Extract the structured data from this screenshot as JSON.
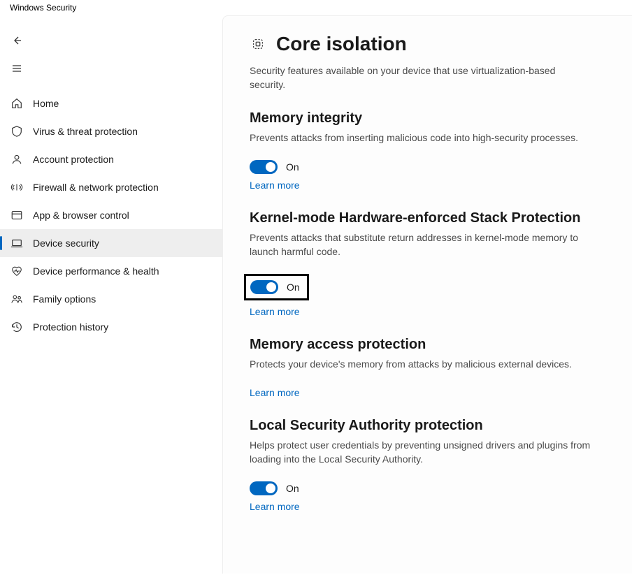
{
  "window_title": "Windows Security",
  "sidebar": {
    "items": [
      {
        "id": "home",
        "label": "Home"
      },
      {
        "id": "virus-threat",
        "label": "Virus & threat protection"
      },
      {
        "id": "account-protection",
        "label": "Account protection"
      },
      {
        "id": "firewall",
        "label": "Firewall & network protection"
      },
      {
        "id": "app-browser",
        "label": "App & browser control"
      },
      {
        "id": "device-security",
        "label": "Device security",
        "selected": true
      },
      {
        "id": "performance-health",
        "label": "Device performance & health"
      },
      {
        "id": "family-options",
        "label": "Family options"
      },
      {
        "id": "protection-history",
        "label": "Protection history"
      }
    ]
  },
  "page": {
    "title": "Core isolation",
    "subtitle": "Security features available on your device that use virtualization-based security."
  },
  "sections": {
    "memory_integrity": {
      "title": "Memory integrity",
      "desc": "Prevents attacks from inserting malicious code into high-security processes.",
      "toggle_state": "On",
      "learn_more": "Learn more"
    },
    "kmhsp": {
      "title": "Kernel-mode Hardware-enforced Stack Protection",
      "desc": "Prevents attacks that substitute return addresses in kernel-mode memory to launch harmful code.",
      "toggle_state": "On",
      "learn_more": "Learn more"
    },
    "memory_access": {
      "title": "Memory access protection",
      "desc": "Protects your device's memory from attacks by malicious external devices.",
      "learn_more": "Learn more"
    },
    "lsa": {
      "title": "Local Security Authority protection",
      "desc": "Helps protect user credentials by preventing unsigned drivers and plugins from loading into the Local Security Authority.",
      "toggle_state": "On",
      "learn_more": "Learn more"
    }
  },
  "colors": {
    "accent": "#0067c0",
    "link": "#0067c0"
  }
}
